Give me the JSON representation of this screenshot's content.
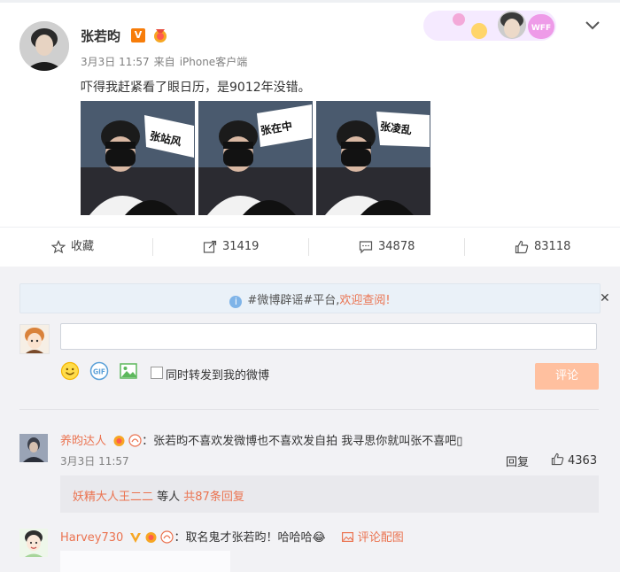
{
  "post": {
    "author": "张若昀",
    "v_badge": "V",
    "date": "3月3日 11:57",
    "source_prefix": "来自",
    "source": "iPhone客户端",
    "text": "吓得我赶紧看了眼日历，是9012年没错。",
    "images": [
      {
        "label": "张站风"
      },
      {
        "label": "张在中"
      },
      {
        "label": "张凌乱"
      }
    ],
    "banner_text": "WFF"
  },
  "actions": {
    "favorite": "收藏",
    "repost": "31419",
    "comment": "34878",
    "like": "83118"
  },
  "notice": {
    "prefix": "#微博辟谣#平台,",
    "highlight": "欢迎查阅!",
    "close": "✕"
  },
  "composer": {
    "placeholder": "",
    "repost_label": "同时转发到我的微博",
    "submit_label": "评论"
  },
  "comments": [
    {
      "user": "养昀达人",
      "text": "：张若昀不喜欢发微博也不喜欢发自拍 我寻思你就叫张不喜吧▯",
      "time": "3月3日 11:57",
      "reply_label": "回复",
      "likes": "4363",
      "sub_reply_user": "妖精大人王二二",
      "sub_reply_mid": " 等人 ",
      "sub_reply_count": "共87条回复"
    },
    {
      "user": "Harvey730",
      "text": "：取名鬼才张若昀！哈哈哈😂",
      "pic_link": "评论配图"
    }
  ],
  "colors": {
    "accent": "#eb7350",
    "submit_bg": "#ffc09f",
    "comment_zone_bg": "#f2f2f5",
    "notice_bg": "#eaf1f8"
  }
}
